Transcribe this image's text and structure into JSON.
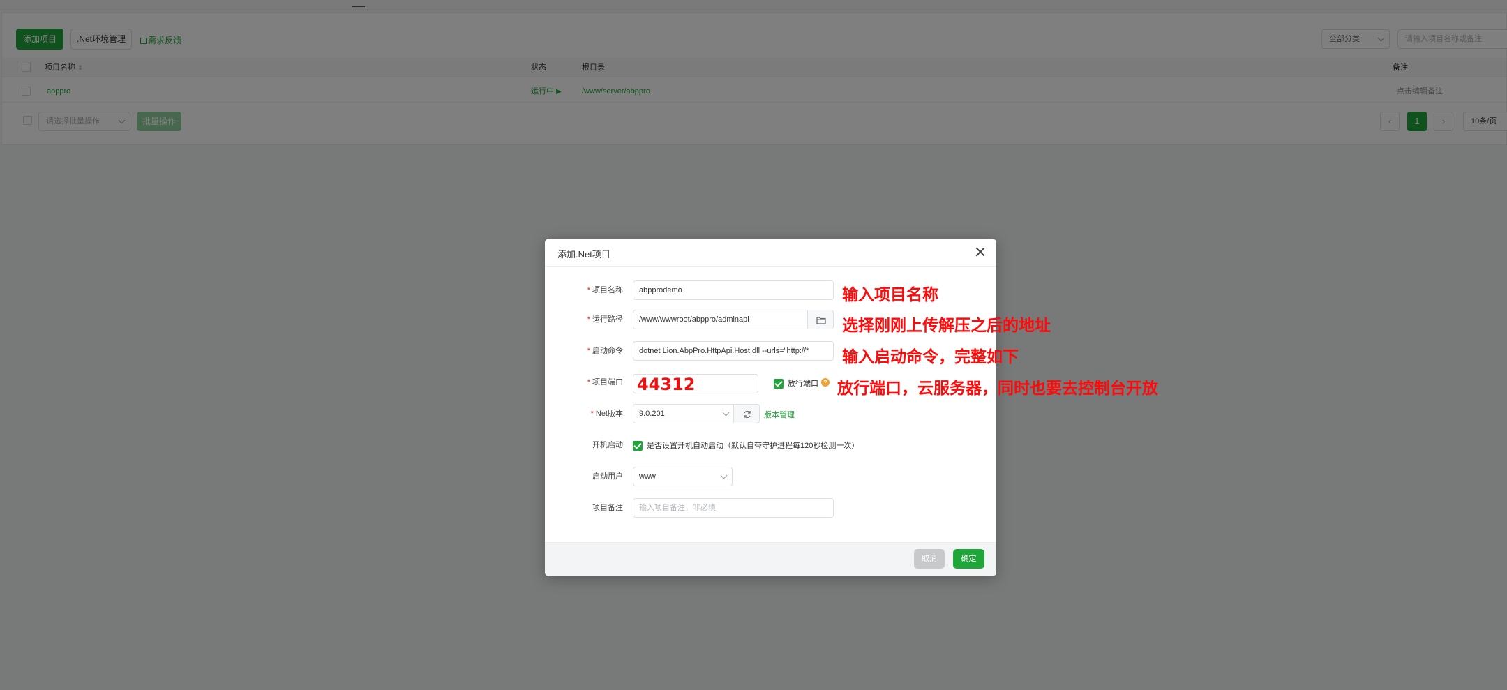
{
  "toolbar": {
    "add_project": "添加项目",
    "net_env_manage": ".Net环境管理",
    "feedback": "需求反馈",
    "category_select": "全部分类",
    "search_placeholder": "请输入项目名称或备注"
  },
  "table": {
    "headers": {
      "name": "项目名称",
      "status": "状态",
      "root": "根目录",
      "remark": "备注"
    },
    "rows": [
      {
        "name": "abppro",
        "status": "运行中",
        "root": "/www/server/abppro",
        "remark": "点击编辑备注"
      }
    ],
    "batch_placeholder": "请选择批量操作",
    "batch_button": "批量操作"
  },
  "pagination": {
    "prev": "‹",
    "current_page": "1",
    "next": "›",
    "page_size": "10条/页"
  },
  "modal": {
    "title": "添加.Net项目",
    "fields": {
      "name": {
        "label": "项目名称",
        "value": "abpprodemo"
      },
      "path": {
        "label": "运行路径",
        "value": "/www/wwwroot/abppro/adminapi"
      },
      "command": {
        "label": "启动命令",
        "value": "dotnet Lion.AbpPro.HttpApi.Host.dll --urls=\"http://*"
      },
      "port": {
        "label": "项目端口",
        "value": "44312",
        "open_port_label": "放行端口"
      },
      "net_version": {
        "label": "Net版本",
        "value": "9.0.201",
        "manage_link": "版本管理"
      },
      "autostart": {
        "label": "开机启动",
        "checkbox_text": "是否设置开机自动启动（默认自带守护进程每120秒检测一次）"
      },
      "user": {
        "label": "启动用户",
        "value": "www"
      },
      "remark": {
        "label": "项目备注",
        "placeholder": "输入项目备注，非必填"
      }
    },
    "cancel": "取消",
    "confirm": "确定"
  },
  "annotations": {
    "a1": "输入项目名称",
    "a2": "选择刚刚上传解压之后的地址",
    "a3": "输入启动命令，完整如下",
    "a4": "放行端口，云服务器，同时也要去控制台开放"
  },
  "colors": {
    "brand_green": "#20a53a",
    "annotation_red": "#ff0a0a",
    "required_red": "#e02020"
  }
}
